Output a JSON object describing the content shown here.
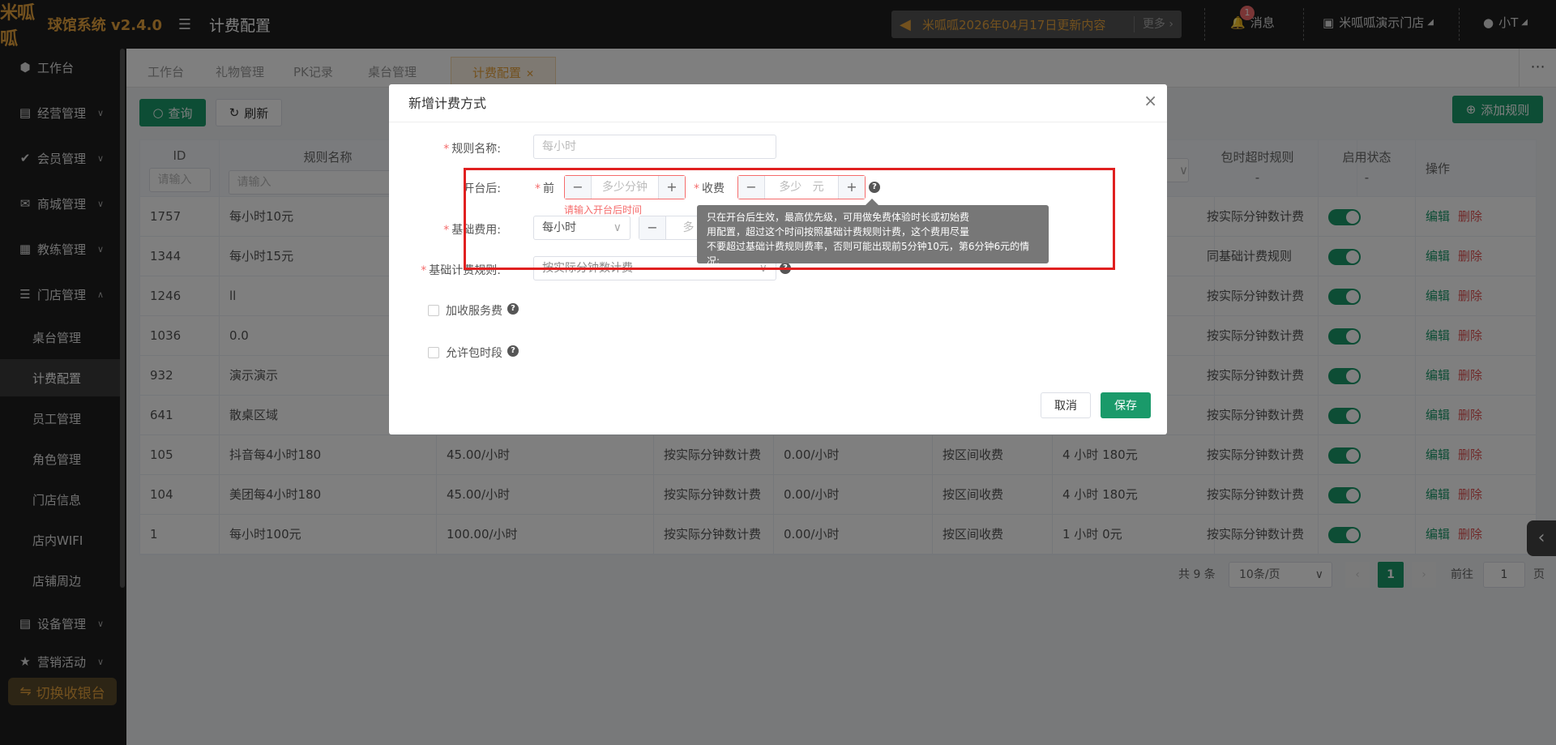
{
  "app": {
    "logo": "米呱呱",
    "name": "球馆系统 v2.4.0",
    "page_title": "计费配置"
  },
  "header": {
    "notice": "米呱呱2026年04月17日更新内容",
    "notice_more": "更多",
    "messages_label": "消息",
    "messages_count": "1",
    "store_label": "米呱呱演示门店",
    "user_label": "小T"
  },
  "sidebar": {
    "items": [
      {
        "label": "工作台",
        "icon": "box-icon"
      },
      {
        "label": "经营管理",
        "icon": "chart-icon"
      },
      {
        "label": "会员管理",
        "icon": "check-icon"
      },
      {
        "label": "商城管理",
        "icon": "mail-icon"
      },
      {
        "label": "教练管理",
        "icon": "car-icon"
      },
      {
        "label": "门店管理",
        "icon": "database-icon"
      }
    ],
    "sub_items": [
      "桌台管理",
      "计费配置",
      "员工管理",
      "角色管理",
      "门店信息",
      "店内WIFI",
      "店铺周边"
    ],
    "bottom_items": [
      {
        "label": "设备管理",
        "icon": "chart-icon"
      },
      {
        "label": "营销活动",
        "icon": "star-icon"
      }
    ],
    "switch_label": "切换收银台"
  },
  "tabs": [
    {
      "label": "工作台"
    },
    {
      "label": "礼物管理"
    },
    {
      "label": "PK记录"
    },
    {
      "label": "桌台管理"
    },
    {
      "label": "计费配置"
    }
  ],
  "toolbar": {
    "query_label": "查询",
    "refresh_label": "刷新",
    "add_rule_label": "添加规则"
  },
  "table": {
    "headers": {
      "id": "ID",
      "name": "规则名称",
      "overtime": "包时超时规则",
      "overtime_sub": "-",
      "status": "启用状态",
      "status_sub": "-",
      "actions": "操作"
    },
    "filter_placeholder": "请输入",
    "rows": [
      {
        "id": "1757",
        "name": "每小时10元",
        "price": "",
        "rule": "",
        "service": "",
        "mode": "",
        "pkg": "",
        "overtime": "按实际分钟数计费"
      },
      {
        "id": "1344",
        "name": "每小时15元",
        "price": "",
        "rule": "",
        "service": "",
        "mode": "",
        "pkg": "",
        "overtime": "同基础计费规则"
      },
      {
        "id": "1246",
        "name": "ll",
        "price": "",
        "rule": "",
        "service": "",
        "mode": "",
        "pkg": "",
        "overtime": "按实际分钟数计费"
      },
      {
        "id": "1036",
        "name": "0.0",
        "price": "",
        "rule": "",
        "service": "",
        "mode": "",
        "pkg": "",
        "overtime": "按实际分钟数计费"
      },
      {
        "id": "932",
        "name": "演示演示",
        "price": "",
        "rule": "",
        "service": "",
        "mode": "",
        "pkg": "",
        "overtime": "按实际分钟数计费"
      },
      {
        "id": "641",
        "name": "散桌区域",
        "price": "",
        "rule": "",
        "service": "",
        "mode": "",
        "pkg": "",
        "overtime": "按实际分钟数计费"
      },
      {
        "id": "105",
        "name": "抖音每4小时180",
        "price": "45.00/小时",
        "rule": "按实际分钟数计费",
        "service": "0.00/小时",
        "mode": "按区间收费",
        "pkg": "4 小时 180元",
        "overtime": "按实际分钟数计费"
      },
      {
        "id": "104",
        "name": "美团每4小时180",
        "price": "45.00/小时",
        "rule": "按实际分钟数计费",
        "service": "0.00/小时",
        "mode": "按区间收费",
        "pkg": "4 小时 180元",
        "overtime": "按实际分钟数计费"
      },
      {
        "id": "1",
        "name": "每小时100元",
        "price": "100.00/小时",
        "rule": "按实际分钟数计费",
        "service": "0.00/小时",
        "mode": "按区间收费",
        "pkg": "1 小时 0元",
        "overtime": "按实际分钟数计费"
      }
    ],
    "edit_label": "编辑",
    "delete_label": "删除"
  },
  "pagination": {
    "total": "共 9 条",
    "page_size": "10条/页",
    "current": "1",
    "goto_label": "前往",
    "goto_value": "1",
    "page_suffix": "页"
  },
  "dialog": {
    "title": "新增计费方式",
    "rule_name_label": "规则名称:",
    "rule_name_placeholder": "每小时",
    "after_open_label": "开台后:",
    "before_label": "前",
    "minutes_placeholder": "多少分钟",
    "charge_label": "收费",
    "amount_placeholder": "多少",
    "amount_unit": "元",
    "minutes_error": "请输入开台后时间",
    "base_fee_label": "基础费用:",
    "base_fee_value": "每小时",
    "base_fee_amount": "多",
    "base_rule_label": "基础计费规则:",
    "base_rule_value": "按实际分钟数计费",
    "service_fee_label": "加收服务费",
    "allow_package_label": "允许包时段",
    "cancel_label": "取消",
    "save_label": "保存",
    "tooltip_lines": [
      "只在开台后生效，最高优先级，可用做免费体验时长或初始费",
      "用配置，超过这个时间按照基础计费规则计费，这个费用尽量",
      "不要超过基础计费规则费率，否则可能出现前5分钟10元，第6分钟6元的情况;"
    ]
  }
}
